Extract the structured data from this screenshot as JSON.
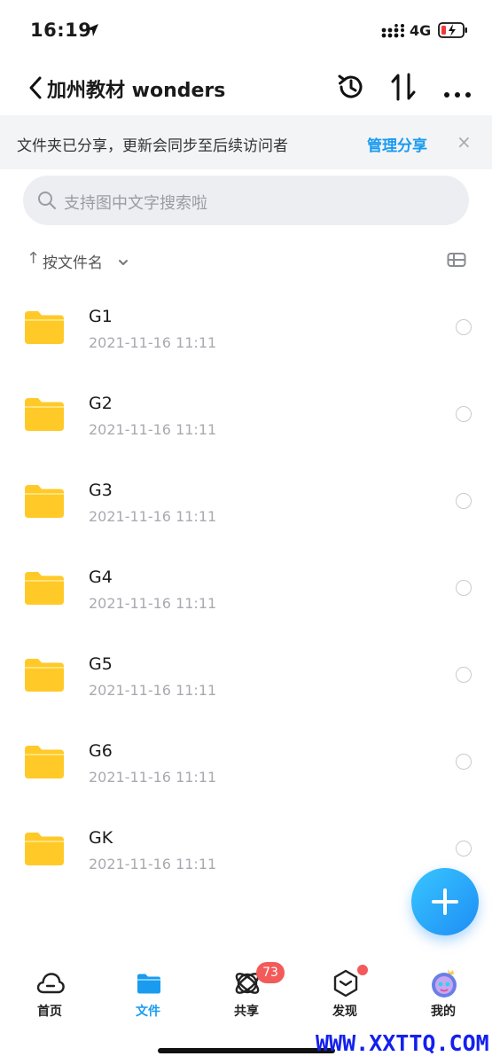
{
  "status_bar": {
    "time": "16:19",
    "network": "4G"
  },
  "nav": {
    "title": "加州教材 wonders"
  },
  "share_banner": {
    "text": "文件夹已分享，更新会同步至后续访问者",
    "action": "管理分享",
    "close": "×"
  },
  "search": {
    "placeholder": "支持图中文字搜索啦"
  },
  "sort": {
    "arrow": "↑",
    "label": "按文件名"
  },
  "files": [
    {
      "name": "G1",
      "time": "2021-11-16 11:11"
    },
    {
      "name": "G2",
      "time": "2021-11-16 11:11"
    },
    {
      "name": "G3",
      "time": "2021-11-16 11:11"
    },
    {
      "name": "G4",
      "time": "2021-11-16 11:11"
    },
    {
      "name": "G5",
      "time": "2021-11-16 11:11"
    },
    {
      "name": "G6",
      "time": "2021-11-16 11:11"
    },
    {
      "name": "GK",
      "time": "2021-11-16 11:11"
    }
  ],
  "tabs": [
    {
      "label": "首页",
      "icon": "cloud-icon"
    },
    {
      "label": "文件",
      "icon": "folder-icon",
      "active": true
    },
    {
      "label": "共享",
      "icon": "orbit-icon",
      "badge": "73"
    },
    {
      "label": "发现",
      "icon": "cube-icon",
      "dot": true
    },
    {
      "label": "我的",
      "icon": "avatar-icon"
    }
  ],
  "watermark": "WWW.XXTTQ.COM",
  "colors": {
    "accent": "#1a9bf0",
    "folder": "#ffc928",
    "badge": "#f35a5a"
  }
}
